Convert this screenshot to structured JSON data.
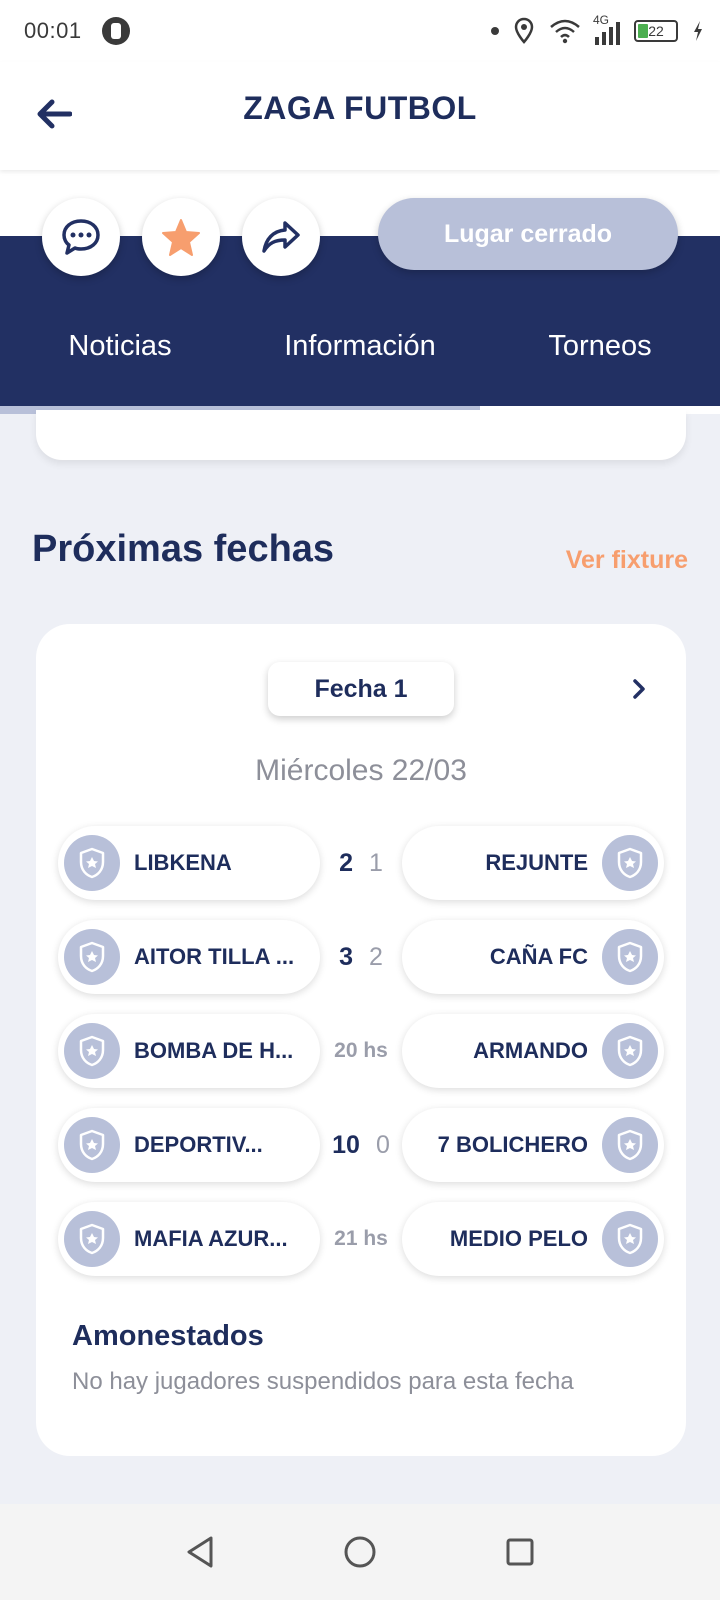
{
  "status_bar": {
    "time": "00:01",
    "network": "4G",
    "battery": "22"
  },
  "header": {
    "title": "ZAGA FUTBOL"
  },
  "actions": {
    "status_label": "Lugar cerrado"
  },
  "tabs": [
    {
      "label": "Noticias"
    },
    {
      "label": "Información"
    },
    {
      "label": "Torneos"
    }
  ],
  "section": {
    "title": "Próximas fechas",
    "link": "Ver fixture"
  },
  "fixture": {
    "round": "Fecha 1",
    "date": "Miércoles 22/03",
    "matches": [
      {
        "home": "LIBKENA",
        "away": "REJUNTE",
        "home_score": "2",
        "away_score": "1",
        "time": ""
      },
      {
        "home": "AITOR TILLA ...",
        "away": "CAÑA FC",
        "home_score": "3",
        "away_score": "2",
        "time": ""
      },
      {
        "home": "BOMBA DE H...",
        "away": "ARMANDO",
        "home_score": "",
        "away_score": "",
        "time": "20 hs"
      },
      {
        "home": "DEPORTIV...",
        "away": "7 BOLICHERO",
        "home_score": "10",
        "away_score": "0",
        "time": ""
      },
      {
        "home": "MAFIA AZUR...",
        "away": "MEDIO PELO",
        "home_score": "",
        "away_score": "",
        "time": "21 hs"
      }
    ]
  },
  "suspended": {
    "title": "Amonestados",
    "text": "No hay jugadores suspendidos para esta fecha"
  },
  "colors": {
    "navy": "#223063",
    "accent": "#f79e6e",
    "muted": "#b8c0d9"
  }
}
